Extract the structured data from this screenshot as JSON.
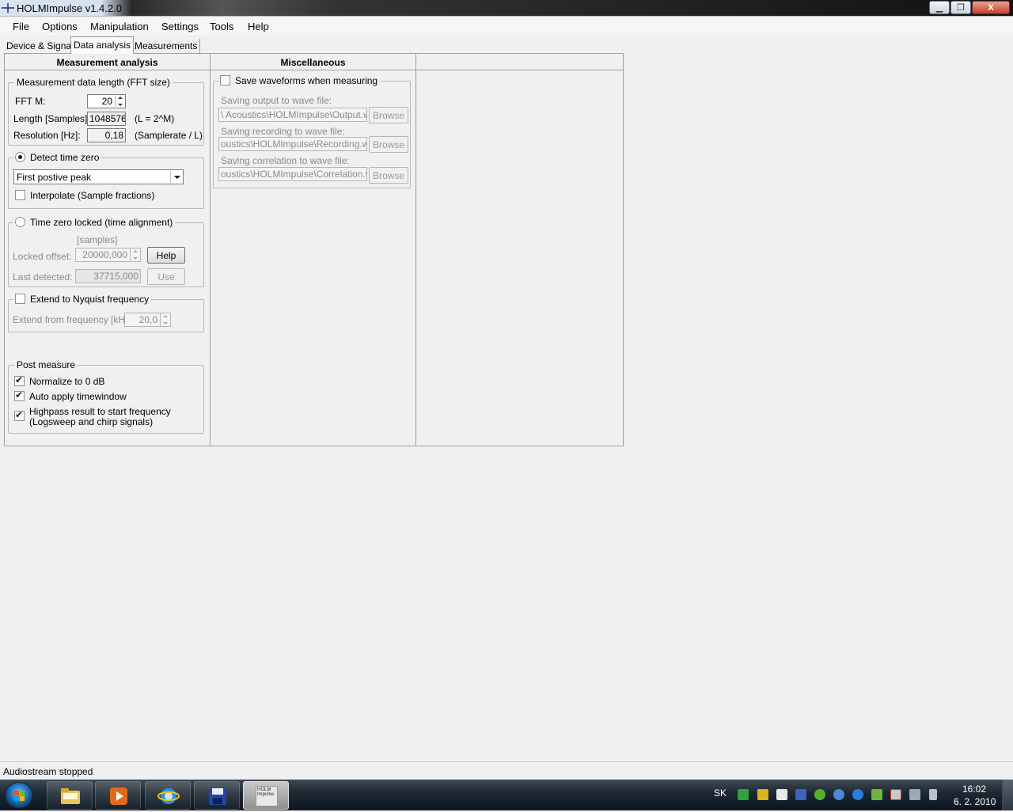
{
  "window": {
    "title": "HOLMImpulse  v1.4.2.0",
    "close_label": "X",
    "min_label": "▁",
    "max_label": "❐"
  },
  "menu": [
    "File",
    "Options",
    "Manipulation",
    "Settings",
    "Tools",
    "Help"
  ],
  "tabs": [
    "Device & Signal",
    "Data analysis",
    "Measurements"
  ],
  "active_tab": "Data analysis",
  "panel": {
    "col1_header": "Measurement analysis",
    "col2_header": "Miscellaneous",
    "fft_group": {
      "legend": "Measurement data length (FFT size)",
      "fft_m_label": "FFT  M:",
      "fft_m_value": "20",
      "length_label": "Length [Samples]:",
      "length_value": "1048576",
      "length_note": "(L = 2^M)",
      "resolution_label": "Resolution [Hz]:",
      "resolution_value": "0,18",
      "resolution_note": "(Samplerate / L)"
    },
    "detect_group": {
      "legend": "Detect time zero",
      "combo_value": "First postive peak",
      "interpolate_label": "Interpolate (Sample fractions)"
    },
    "locked_group": {
      "legend": "Time zero locked (time alignment)",
      "samples_label": "[samples]",
      "locked_offset_label": "Locked offset:",
      "locked_offset_value": "20000,000",
      "help_label": "Help",
      "last_detected_label": "Last detected:",
      "last_detected_value": "37715,000",
      "use_label": "Use"
    },
    "nyquist_group": {
      "legend": "Extend to Nyquist frequency",
      "extend_label": "Extend from frequency [kHz]:",
      "extend_value": "20,0"
    },
    "post_group": {
      "legend": "Post measure",
      "normalize_label": "Normalize to 0 dB",
      "auto_tw_label": "Auto apply timewindow",
      "highpass_label_1": "Highpass result to start frequency",
      "highpass_label_2": "(Logsweep and chirp signals)"
    },
    "misc_group": {
      "legend": "Save waveforms when measuring",
      "output_label": "Saving output to wave file:",
      "output_value": "\\ Acoustics\\HOLMImpulse\\Output.wav",
      "recording_label": "Saving recording to wave file:",
      "recording_value": "oustics\\HOLMImpulse\\Recording.wav",
      "correlation_label": "Saving correlation to wave file:",
      "correlation_value": "oustics\\HOLMImpulse\\Correlation.wav",
      "browse_label": "Browse"
    }
  },
  "status": "Audiostream stopped",
  "taskbar": {
    "lang": "SK",
    "time": "16:02",
    "date": "6. 2. 2010",
    "holm_btn_text": "HOLM Impulse"
  }
}
